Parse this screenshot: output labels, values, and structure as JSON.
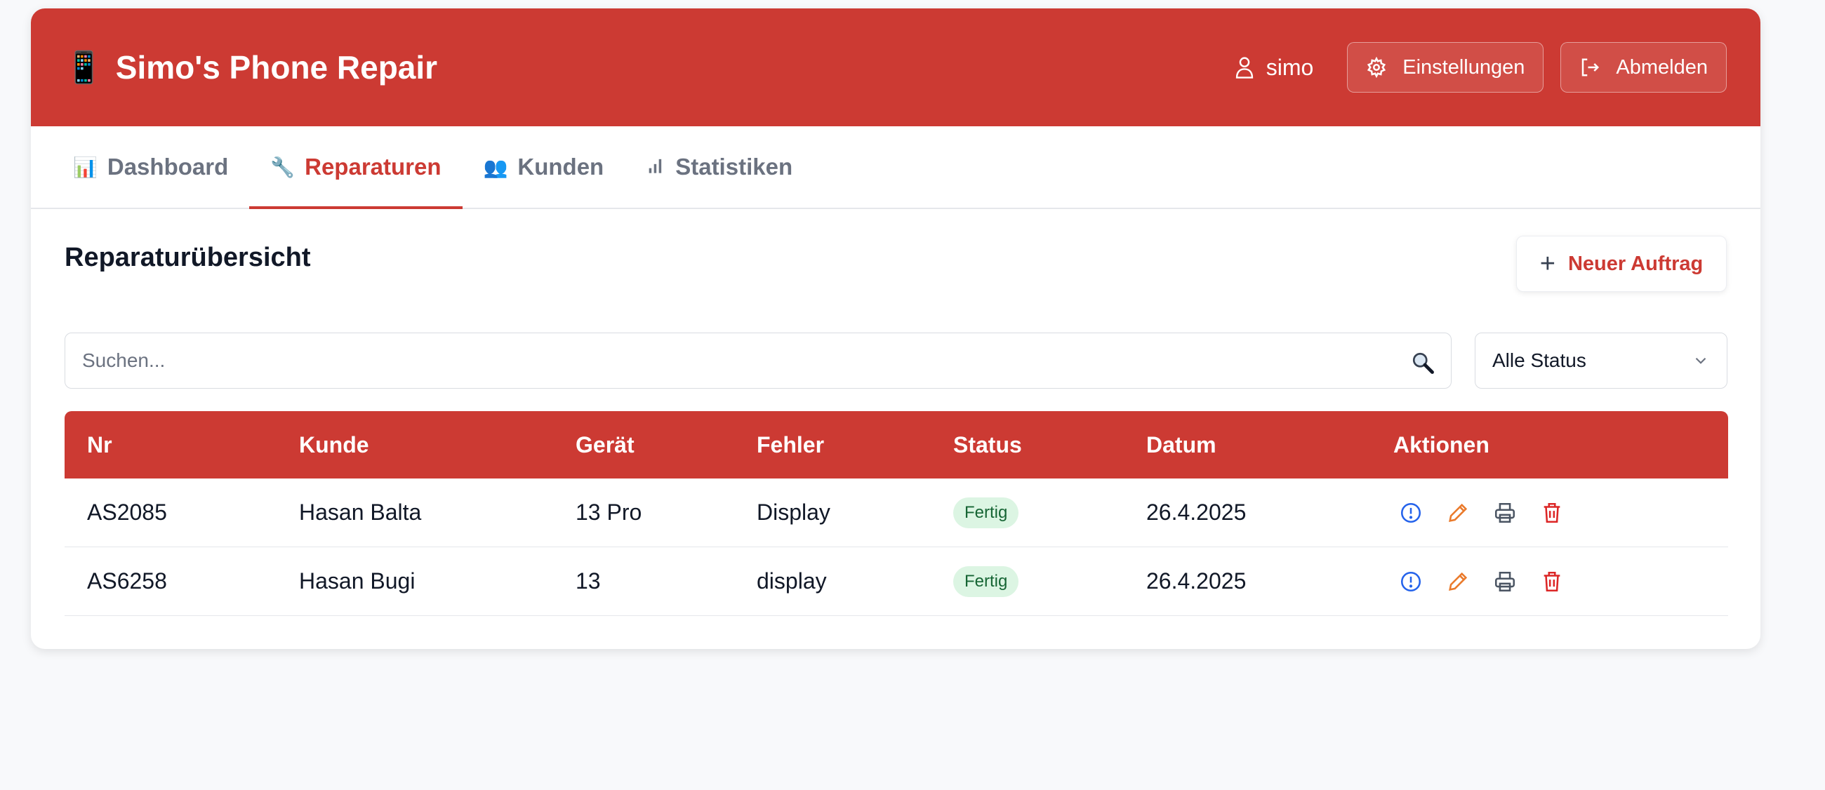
{
  "header": {
    "app_icon": "📱",
    "title": "Simo's Phone Repair",
    "username": "simo",
    "settings_label": "Einstellungen",
    "logout_label": "Abmelden"
  },
  "tabs": [
    {
      "icon": "📊",
      "label": "Dashboard"
    },
    {
      "icon": "🔧",
      "label": "Reparaturen"
    },
    {
      "icon": "📶",
      "label": "Statistiken"
    },
    {
      "icon": "👥",
      "label": "Kunden"
    }
  ],
  "main": {
    "title": "Reparaturübersicht",
    "new_order_label": "Neuer Auftrag",
    "search_placeholder": "Suchen...",
    "status_filter": "Alle Status"
  },
  "table": {
    "headers": [
      "Nr",
      "Kunde",
      "Gerät",
      "Fehler",
      "Status",
      "Datum",
      "Aktionen"
    ],
    "rows": [
      {
        "nr": "AS2085",
        "kunde": "Hasan Balta",
        "geraet": "13 Pro",
        "fehler": "Display",
        "status": "Fertig",
        "datum": "26.4.2025"
      },
      {
        "nr": "AS6258",
        "kunde": "Hasan Bugi",
        "geraet": "13",
        "fehler": "display",
        "status": "Fertig",
        "datum": "26.4.2025"
      }
    ]
  },
  "colors": {
    "accent": "#cc3a33",
    "badge_bg": "#dcf5e3",
    "badge_text": "#166534",
    "info_icon": "#2563eb",
    "edit_icon": "#ea7a2b",
    "print_icon": "#4b5563",
    "delete_icon": "#dc2626"
  }
}
